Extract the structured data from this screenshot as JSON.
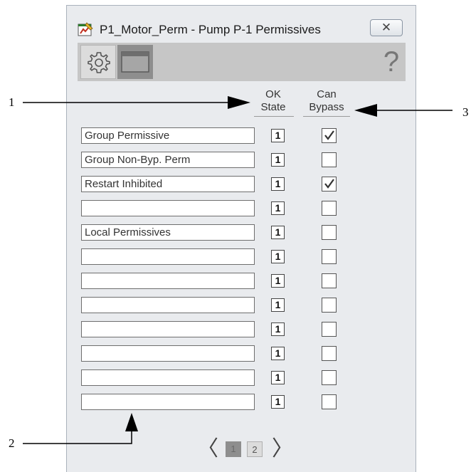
{
  "window": {
    "title": "P1_Motor_Perm - Pump P-1 Permissives",
    "close_glyph": "✕",
    "app_icon": "faceplate-app-icon"
  },
  "toolbar": {
    "help_glyph": "?",
    "tools": [
      {
        "name": "configuration",
        "icon": "gear-icon"
      },
      {
        "name": "faceplate",
        "icon": "window-icon"
      }
    ]
  },
  "columns": {
    "ok_state": [
      "OK",
      "State"
    ],
    "can_bypass": [
      "Can",
      "Bypass"
    ]
  },
  "permissives": [
    {
      "name": "Group Permissive",
      "ok_state": "1",
      "can_bypass": true
    },
    {
      "name": "Group Non-Byp. Perm",
      "ok_state": "1",
      "can_bypass": false
    },
    {
      "name": "Restart Inhibited",
      "ok_state": "1",
      "can_bypass": true
    },
    {
      "name": "",
      "ok_state": "1",
      "can_bypass": false
    },
    {
      "name": "Local Permissives",
      "ok_state": "1",
      "can_bypass": false
    },
    {
      "name": "",
      "ok_state": "1",
      "can_bypass": false
    },
    {
      "name": "",
      "ok_state": "1",
      "can_bypass": false
    },
    {
      "name": "",
      "ok_state": "1",
      "can_bypass": false
    },
    {
      "name": "",
      "ok_state": "1",
      "can_bypass": false
    },
    {
      "name": "",
      "ok_state": "1",
      "can_bypass": false
    },
    {
      "name": "",
      "ok_state": "1",
      "can_bypass": false
    },
    {
      "name": "",
      "ok_state": "1",
      "can_bypass": false
    }
  ],
  "pager": {
    "prev": "〈",
    "next": "〉",
    "pages": [
      "1",
      "2"
    ],
    "current_page": 1
  },
  "callouts": {
    "c1": "1",
    "c2": "2",
    "c3": "3"
  },
  "colors": {
    "window_bg": "#e9ebee",
    "toolbar_bg": "#c6c6c6",
    "active_page": "#8e8e8e"
  }
}
